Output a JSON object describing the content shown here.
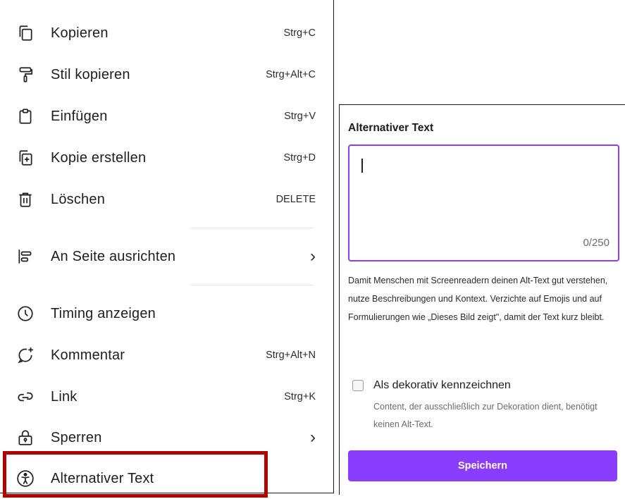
{
  "menu": {
    "items": [
      {
        "label": "Kopieren",
        "shortcut": "Strg+C",
        "icon": "copy-icon"
      },
      {
        "label": "Stil kopieren",
        "shortcut": "Strg+Alt+C",
        "icon": "paint-roller-icon"
      },
      {
        "label": "Einfügen",
        "shortcut": "Strg+V",
        "icon": "clipboard-icon"
      },
      {
        "label": "Kopie erstellen",
        "shortcut": "Strg+D",
        "icon": "duplicate-icon"
      },
      {
        "label": "Löschen",
        "shortcut": "DELETE",
        "icon": "trash-icon"
      },
      {
        "label": "An Seite ausrichten",
        "chevron": "›",
        "icon": "align-icon"
      },
      {
        "label": "Timing anzeigen",
        "icon": "clock-icon"
      },
      {
        "label": "Kommentar",
        "shortcut": "Strg+Alt+N",
        "icon": "comment-add-icon"
      },
      {
        "label": "Link",
        "shortcut": "Strg+K",
        "icon": "link-icon"
      },
      {
        "label": "Sperren",
        "chevron": "›",
        "icon": "lock-icon"
      },
      {
        "label": "Alternativer Text",
        "icon": "accessibility-icon"
      }
    ]
  },
  "alt_text_panel": {
    "title": "Alternativer Text",
    "textarea_value": "",
    "counter": "0/250",
    "help_text": "Damit Menschen mit Screenreadern deinen Alt-Text gut verstehen, nutze Beschreibungen und Kontext. Verzichte auf Emojis und auf Formulierungen wie „Dieses Bild zeigt\", damit der Text kurz bleibt.",
    "checkbox_label": "Als dekorativ kennzeichnen",
    "checkbox_checked": false,
    "checkbox_description": "Content, der ausschließlich zur Dekoration dient, benötigt keinen Alt-Text.",
    "save_label": "Speichern"
  },
  "colors": {
    "accent": "#8b3dff",
    "highlight_border": "#b00000"
  }
}
